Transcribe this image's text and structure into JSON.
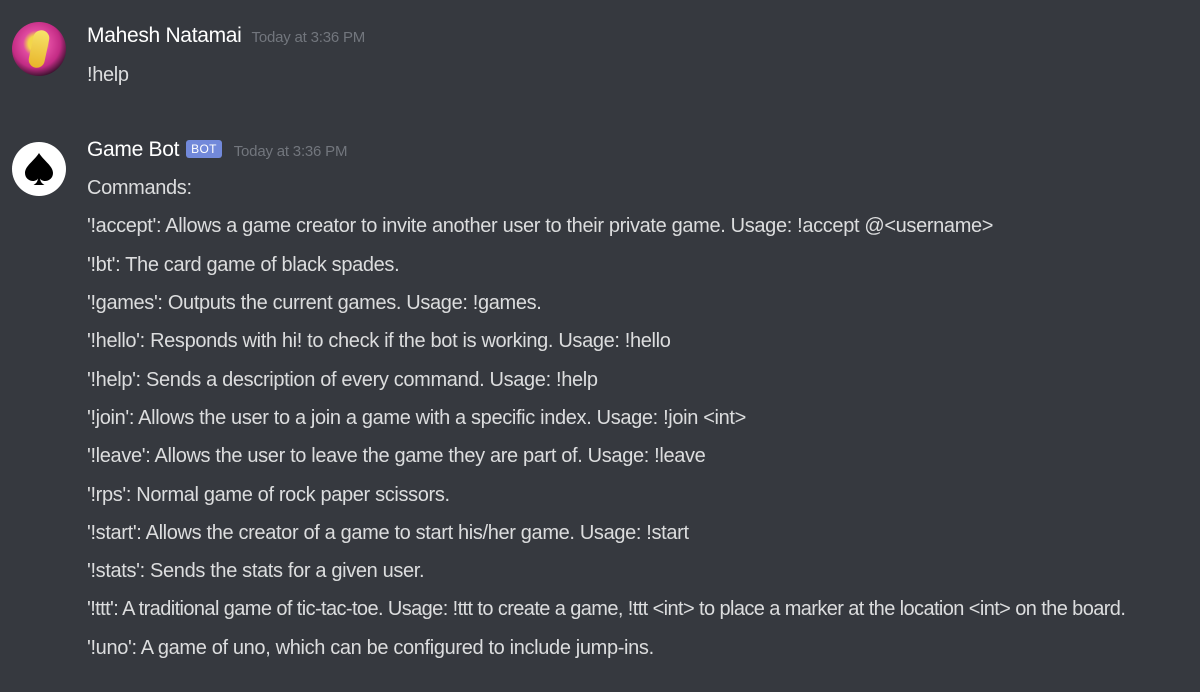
{
  "messages": [
    {
      "author": "Mahesh Natamai",
      "timestamp": "Today at 3:36 PM",
      "content": "!help"
    },
    {
      "author": "Game Bot",
      "badge": "BOT",
      "timestamp": "Today at 3:36 PM",
      "lines": [
        "Commands:",
        "'!accept': Allows a game creator to invite another user to their private game. Usage: !accept @<username>",
        "'!bt': The card game of black spades.",
        "'!games': Outputs the current games. Usage: !games.",
        "'!hello': Responds with hi! to check if the bot is working. Usage: !hello",
        "'!help': Sends a description of every command. Usage: !help",
        "'!join': Allows the user to a join a game with a specific index. Usage: !join <int>",
        "'!leave': Allows the user to leave the game they are part of. Usage: !leave",
        "'!rps': Normal game of rock paper scissors.",
        "'!start': Allows the creator of a game to start his/her game. Usage: !start",
        "'!stats': Sends the stats for a given user.",
        "'!ttt': A traditional game of tic-tac-toe. Usage: !ttt to create a game, !ttt <int> to place a marker at the location <int> on the board.",
        "'!uno': A game of uno, which can be configured to include jump-ins."
      ]
    }
  ],
  "icons": {
    "user_avatar": "avatar-image",
    "bot_avatar": "spade-icon"
  },
  "colors": {
    "background": "#36393f",
    "username": "#ffffff",
    "timestamp": "#72767d",
    "text": "#dcddde",
    "bot_badge": "#7289da"
  }
}
